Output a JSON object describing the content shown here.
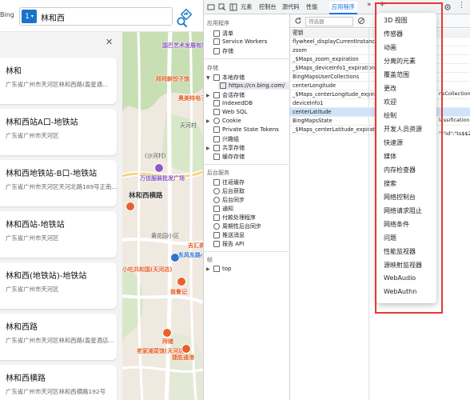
{
  "maps": {
    "brand": "Bing",
    "search": {
      "badge": "1",
      "query": "林和西"
    },
    "results": [
      {
        "title": "林和",
        "address": "广东省广州市天河区林和西路(盈星通..."
      },
      {
        "title": "林和西站A口-地铁站",
        "address": "广东省广州市天河区"
      },
      {
        "title": "林和西地铁站-B口-地铁站",
        "address": "广东省广州市天河区天河北路189号正南..."
      },
      {
        "title": "林和西站-地铁站",
        "address": "广东省广州市天河区"
      },
      {
        "title": "林和西(地铁站)-地铁站",
        "address": "广东省广州市天河区"
      },
      {
        "title": "林和西路",
        "address": "广东省广州市天河区林和西路(盈星酒店..."
      },
      {
        "title": "林和西横路",
        "address": "广东省广州市天河区林和西横路192号"
      }
    ],
    "map_labels": {
      "poi1": "国巴艺术发展有限公司",
      "poi2": "拜拜鲜饺子馆",
      "poi3": "奥美特电子商城",
      "place1": "天河村",
      "place2": "(沙河村)",
      "poi4": "万佳服装批发广场",
      "road": "林和西横路",
      "place3": "黄花园小区",
      "poi5": "吉汇茶",
      "poi6": "东风东路小学",
      "poi7": "小吃共和国(天河店)",
      "poi8": "翁鲁记",
      "poi9": "老家湘菜馆(天河店)",
      "poi10": "拜猪",
      "poi11": "捷胜通港"
    }
  },
  "devtools": {
    "tabs": [
      "元素",
      "控制台",
      "源代码",
      "性能",
      "应用程序"
    ],
    "active_tab": "应用程序",
    "sidebar": {
      "app_header": "应用程序",
      "app_items": [
        "清单",
        "Service Workers",
        "存储"
      ],
      "storage_header": "存储",
      "local_storage": "本地存储",
      "local_storage_child": "https://cn.bing.com/",
      "storage_items": [
        "会话存储",
        "IndexedDB",
        "Web SQL",
        "Cookie",
        "Private State Tokens",
        "兴趣组",
        "共享存储",
        "缓存存储"
      ],
      "bg_header": "后台服务",
      "bg_items": [
        "往返缓存",
        "后台获取",
        "后台同步",
        "通知",
        "付款处理程序",
        "周期性后台同步",
        "推送消息",
        "报告 API"
      ],
      "frames_header": "帧",
      "frames_item": "top"
    },
    "storage": {
      "filter_placeholder": "筛选器",
      "header": "密钥",
      "rows": [
        "flywheel_displayCurrentInstance",
        "zoom",
        "_$Maps_zoom_expiration",
        "_$Maps_deviceInfo1_expiration",
        "BingMapsUserCollections",
        "centerLongitude",
        "_$Maps_centerLongitude_expiration",
        "deviceInfo1",
        "centerLatitude",
        "BingMapsState",
        "_$Maps_centerLatitude_expiration"
      ],
      "selected_row": "centerLatitude",
      "right_fragments": [
        "nsCollection\",",
        "lassification\":",
        "\":\"id\":\"ts$$2..."
      ]
    },
    "menu": {
      "items": [
        "3D 视图",
        "传感器",
        "动画",
        "分离的元素",
        "覆盖范围",
        "更改",
        "欢迎",
        "绘制",
        "开发人员资源",
        "快速源",
        "媒体",
        "内存检查器",
        "搜索",
        "网络控制台",
        "网络请求阻止",
        "网络条件",
        "问题",
        "性能监视器",
        "源映射监视器",
        "WebAudio",
        "WebAuthn"
      ]
    }
  },
  "colors": {
    "accent": "#1a73c9",
    "highlight_box": "#e53935",
    "selected_row": "#cfe3fb",
    "map_green": "#c8dfb4",
    "poi_orange": "#e8612c",
    "poi_purple": "#8e5bc4",
    "poi_blue": "#2f73d1"
  }
}
